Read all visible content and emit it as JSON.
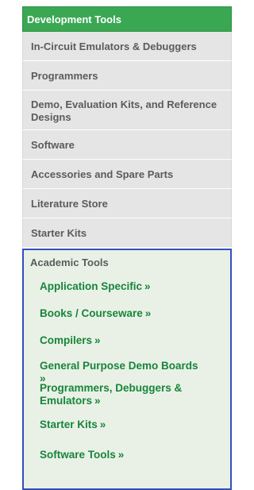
{
  "header": {
    "title": "Development Tools"
  },
  "items": [
    {
      "label": "In-Circuit Emulators & Debuggers"
    },
    {
      "label": "Programmers"
    },
    {
      "label": "Demo, Evaluation Kits, and Reference Designs"
    },
    {
      "label": "Software"
    },
    {
      "label": "Accessories and Spare Parts"
    },
    {
      "label": "Literature Store"
    },
    {
      "label": "Starter Kits"
    }
  ],
  "academic": {
    "title": "Academic Tools",
    "arrow": "»",
    "links": [
      {
        "label": "Application Specific"
      },
      {
        "label": "Books / Courseware"
      },
      {
        "label": "Compilers"
      },
      {
        "label": "General Purpose Demo Boards"
      },
      {
        "label": "Programmers, Debuggers & Emulators"
      },
      {
        "label": "Starter Kits"
      },
      {
        "label": "Software Tools"
      }
    ]
  },
  "colors": {
    "header_bg": "#3aa853",
    "item_bg": "#e5e5e5",
    "link": "#17853a",
    "border": "#3450b8"
  }
}
